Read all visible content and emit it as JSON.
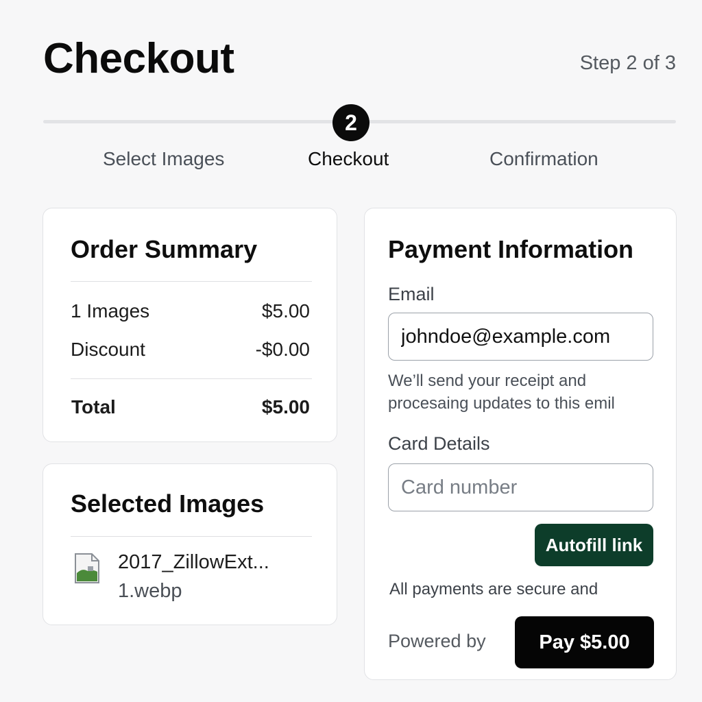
{
  "header": {
    "title": "Checkout",
    "step_indicator": "Step 2 of 3"
  },
  "stepper": {
    "current_step_number": "2",
    "steps": [
      {
        "label": "Select Images"
      },
      {
        "label": "Checkout"
      },
      {
        "label": "Confirmation"
      }
    ]
  },
  "order_summary": {
    "title": "Order Summary",
    "rows": [
      {
        "label": "1 Images",
        "value": "$5.00"
      },
      {
        "label": "Discount",
        "value": "-$0.00"
      }
    ],
    "total_label": "Total",
    "total_value": "$5.00"
  },
  "selected_images": {
    "title": "Selected Images",
    "files": [
      {
        "name_line1": "2017_ZillowExt...",
        "name_line2": "1.webp",
        "icon": "image-file-icon"
      }
    ]
  },
  "payment": {
    "title": "Payment Information",
    "email_label": "Email",
    "email_value": "johndoe@example.com",
    "email_help": "We’ll send your receipt and procesaing updates to this emil",
    "card_label": "Card Details",
    "card_placeholder": "Card number",
    "autofill_label": "Autofill link",
    "secure_text": "All payments are secure and",
    "powered_by": "Powered by",
    "pay_label": "Pay $5.00"
  },
  "colors": {
    "accent_dark": "#0b0b0b",
    "autofill_green": "#0d3d2a",
    "background": "#f7f7f8"
  }
}
